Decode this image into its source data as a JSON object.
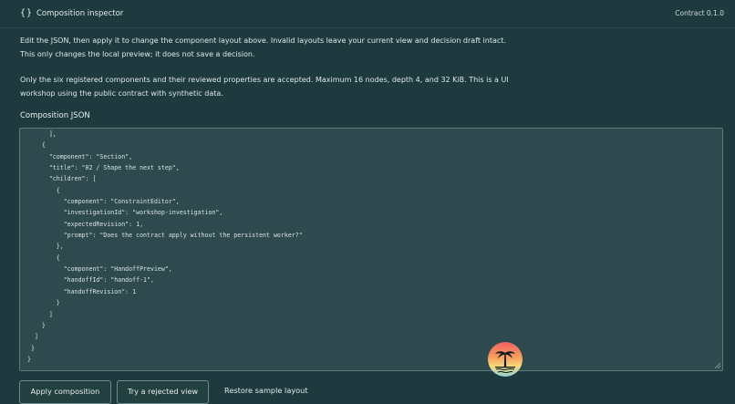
{
  "header": {
    "icon": "braces-icon",
    "icon_glyph": "{}",
    "title": "Composition inspector",
    "version": "Contract 0.1.0"
  },
  "intro": {
    "line1": "Edit the JSON, then apply it to change the component layout above. Invalid layouts leave your current view and decision draft intact.",
    "line2": "This only changes the local preview; it does not save a decision.",
    "line3": "Only the six registered components and their reviewed properties are accepted. Maximum 16 nodes, depth 4, and 32 KiB. This is a UI",
    "line4": "workshop using the public contract with synthetic data."
  },
  "editor": {
    "label": "Composition JSON",
    "code": "      ],\n    {\n      \"component\": \"Section\",\n      \"title\": \"02 / Shape the next step\",\n      \"children\": [\n        {\n          \"component\": \"ConstraintEditor\",\n          \"investigationId\": \"workshop-investigation\",\n          \"expectedRevision\": 1,\n          \"prompt\": \"Does the contract apply without the persistent worker?\"\n        },\n        {\n          \"component\": \"HandoffPreview\",\n          \"handoffId\": \"handoff-1\",\n          \"handoffRevision\": 1\n        }\n      ]\n    }\n  ]\n }\n}"
  },
  "actions": {
    "apply_label": "Apply composition",
    "reject_label": "Try a rejected view",
    "restore_label": "Restore sample layout"
  },
  "floating": {
    "icon": "palm-tree-sunset-icon"
  },
  "colors": {
    "background": "#1e3a3f",
    "editor_bg": "#2e4a4f",
    "text": "#e3ece9"
  }
}
